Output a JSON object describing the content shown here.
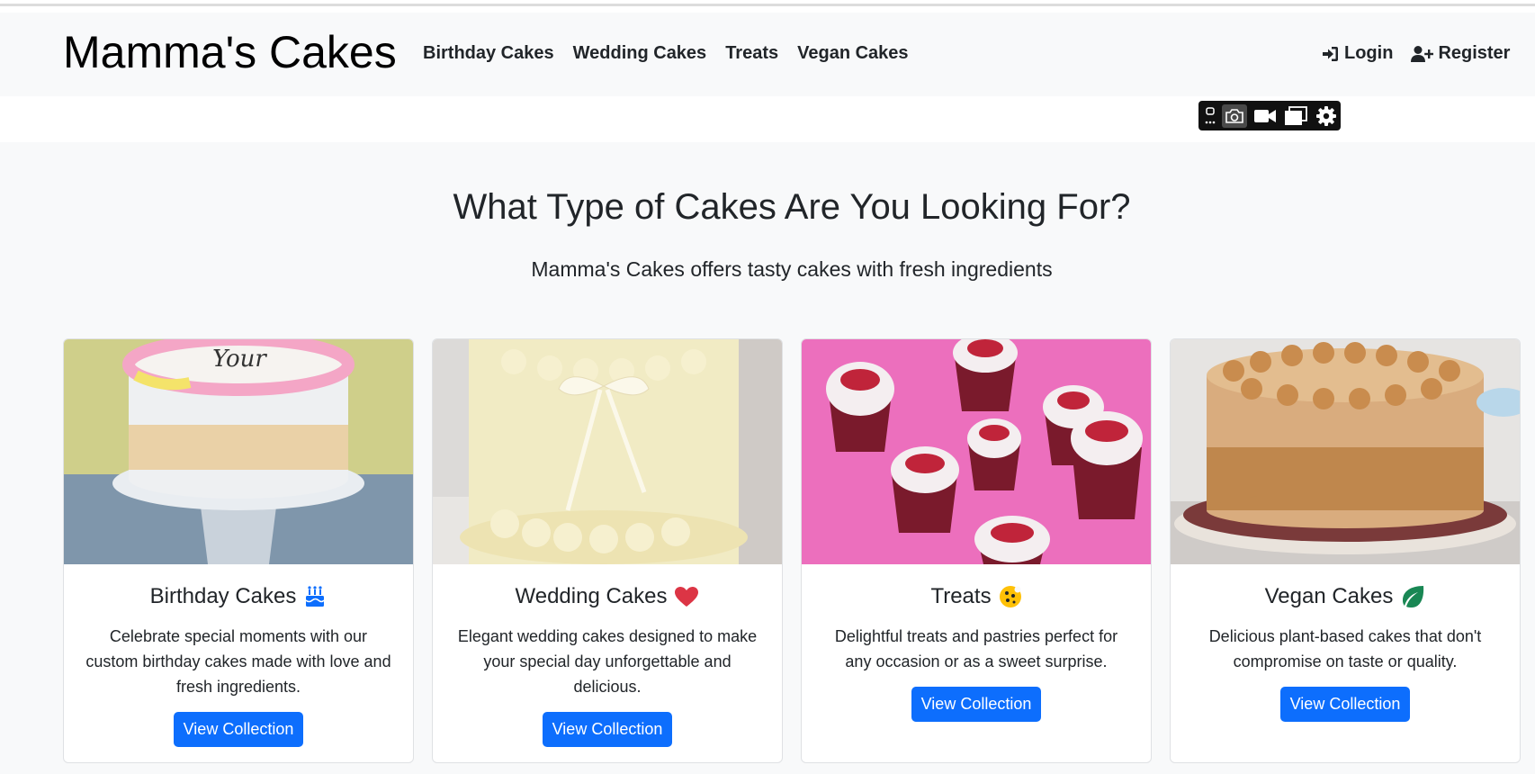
{
  "brand": "Mamma's Cakes",
  "nav": {
    "links": [
      "Birthday Cakes",
      "Wedding Cakes",
      "Treats",
      "Vegan Cakes"
    ],
    "login": "Login",
    "register": "Register"
  },
  "hero": {
    "title": "What Type of Cakes Are You Looking For?",
    "subtitle": "Mamma's Cakes offers tasty cakes with fresh ingredients"
  },
  "cards": [
    {
      "title": "Birthday Cakes",
      "icon": "birthday-cake-icon",
      "text": "Celebrate special moments with our custom birthday cakes made with love and fresh ingredients.",
      "button": "View Collection"
    },
    {
      "title": "Wedding Cakes",
      "icon": "heart-icon",
      "text": "Elegant wedding cakes designed to make your special day unforgettable and delicious.",
      "button": "View Collection"
    },
    {
      "title": "Treats",
      "icon": "cookie-icon",
      "text": "Delightful treats and pastries perfect for any occasion or as a sweet surprise.",
      "button": "View Collection"
    },
    {
      "title": "Vegan Cakes",
      "icon": "leaf-icon",
      "text": "Delicious plant-based cakes that don't compromise on taste or quality.",
      "button": "View Collection"
    }
  ],
  "colors": {
    "primary": "#0d6efd",
    "navbar_bg": "#f8f9fa",
    "page_bg": "#f8f9fa",
    "birthday_icon": "#0d6efd",
    "heart_icon": "#dc3545",
    "cookie_icon": "#ffc107",
    "leaf_icon": "#198754"
  }
}
